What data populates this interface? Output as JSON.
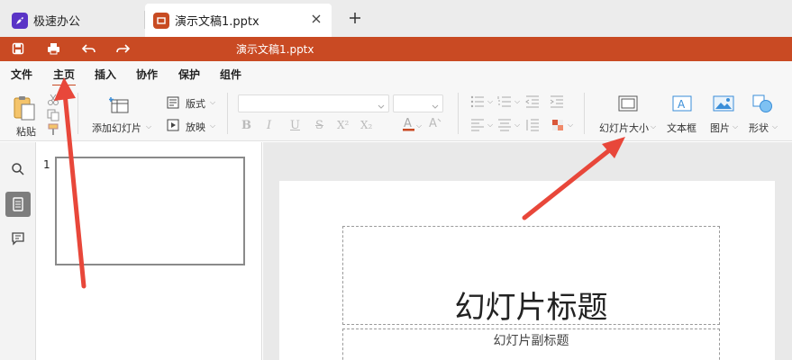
{
  "tabs": [
    {
      "label": "极速办公",
      "icon": "rocket-icon"
    },
    {
      "label": "演示文稿1.pptx",
      "icon": "presentation-icon"
    }
  ],
  "titlebar": {
    "document_title": "演示文稿1.pptx"
  },
  "menu": [
    "文件",
    "主页",
    "插入",
    "协作",
    "保护",
    "组件"
  ],
  "active_menu": "主页",
  "ribbon": {
    "paste": "粘贴",
    "add_slide": "添加幻灯片",
    "layout": "版式",
    "play": "放映",
    "format_buttons": [
      "B",
      "I",
      "U",
      "S",
      "X²",
      "X₂"
    ],
    "slide_size": "幻灯片大小",
    "text_box": "文本框",
    "picture": "图片",
    "shape": "形状"
  },
  "thumbnails": [
    {
      "number": "1"
    }
  ],
  "slide": {
    "title": "幻灯片标题",
    "subtitle": "幻灯片副标题"
  },
  "colors": {
    "accent": "#c94a23",
    "annotation": "#e8473a"
  }
}
